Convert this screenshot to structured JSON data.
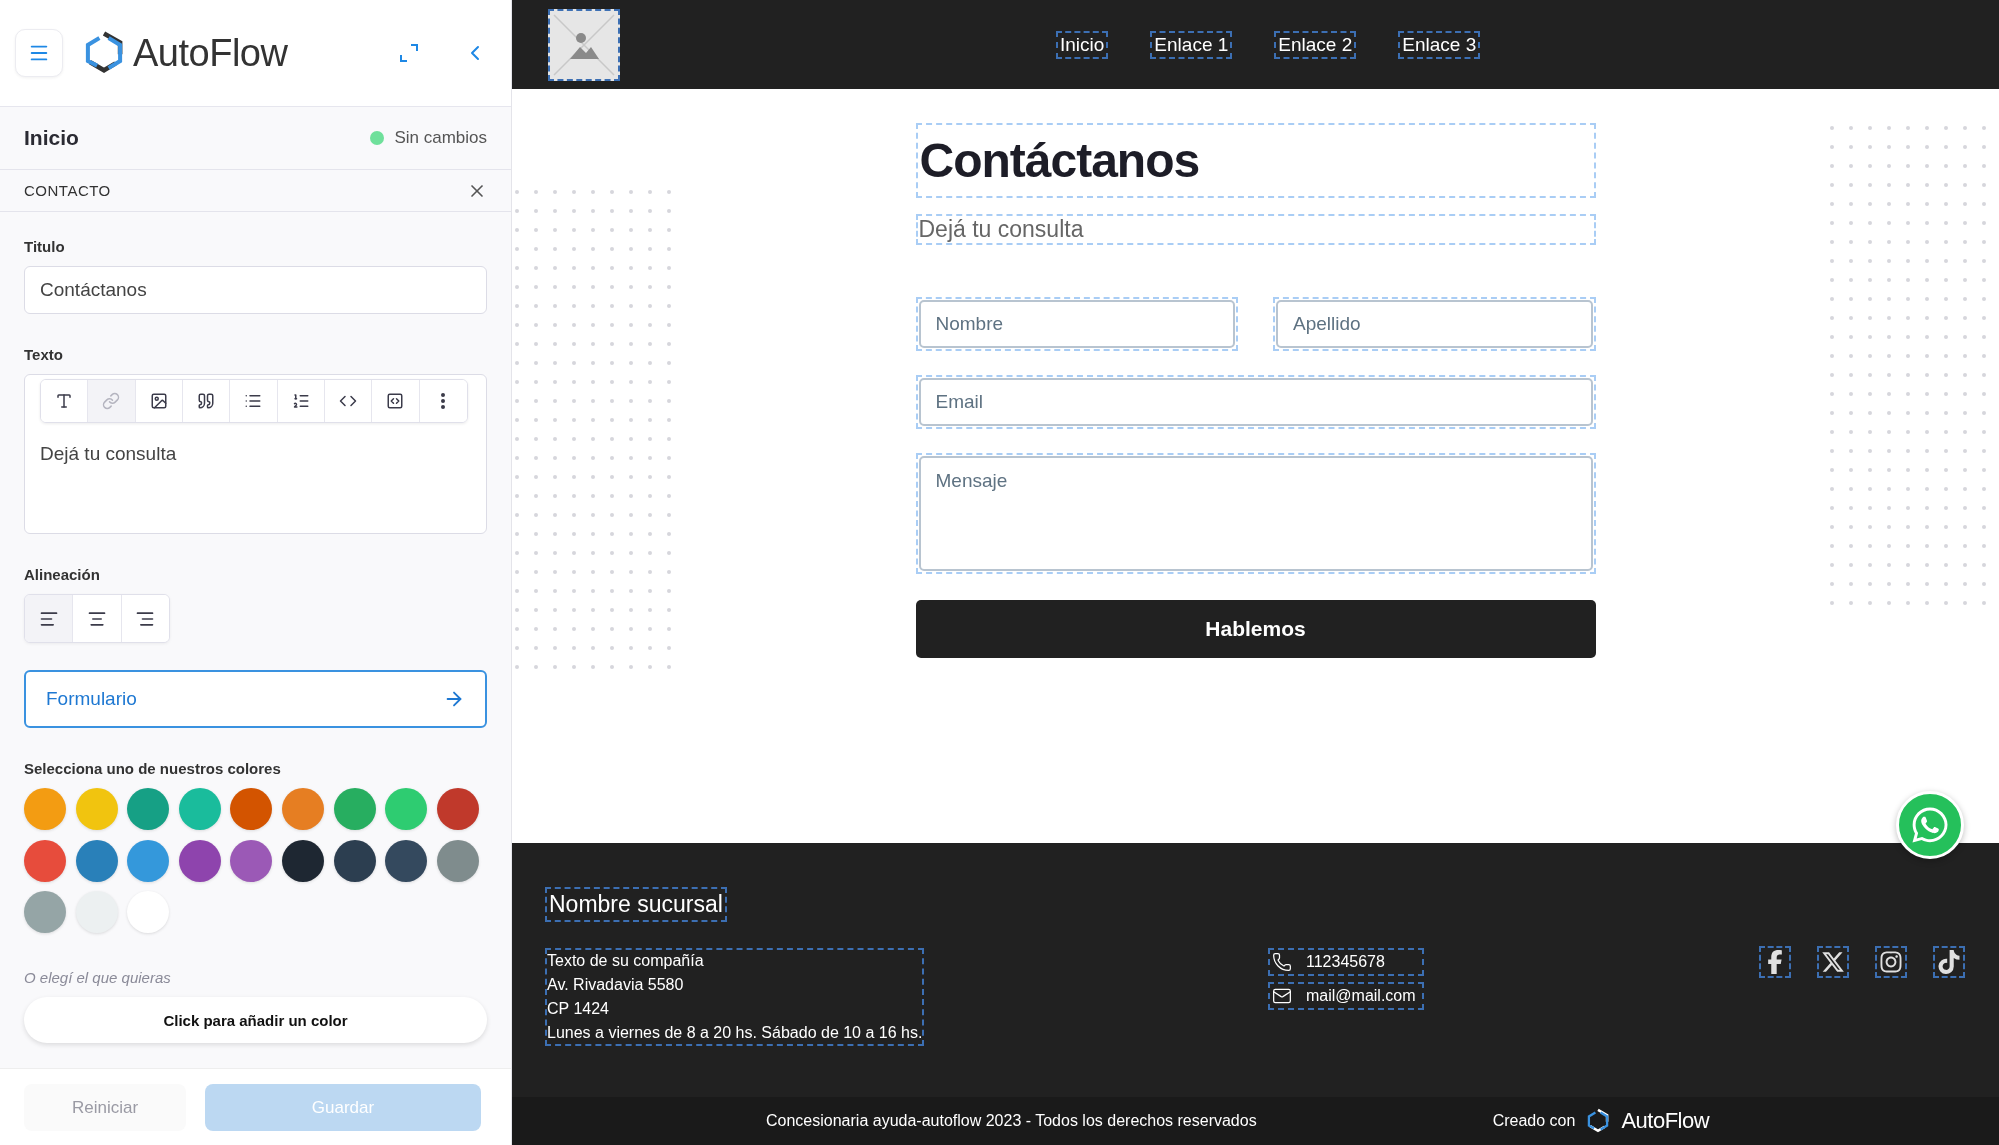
{
  "sidebar": {
    "logo": "**Auto**Flow",
    "page": {
      "title": "Inicio",
      "status": "Sin cambios"
    },
    "section": "CONTACTO",
    "fields": {
      "title_label": "Titulo",
      "title_value": "Contáctanos",
      "text_label": "Texto",
      "text_value": "Dejá tu consulta"
    },
    "toolbar": [
      {
        "kind": "text-size",
        "disabled": false
      },
      {
        "kind": "link",
        "disabled": true
      },
      {
        "kind": "image",
        "disabled": false
      },
      {
        "kind": "quote",
        "disabled": false
      },
      {
        "kind": "bullet-list",
        "disabled": false
      },
      {
        "kind": "numbered-list",
        "disabled": false
      },
      {
        "kind": "code",
        "disabled": false
      },
      {
        "kind": "code-block",
        "disabled": false
      },
      {
        "kind": "more",
        "disabled": false
      }
    ],
    "alignment_label": "Alineación",
    "alignment": [
      {
        "kind": "left",
        "selected": true
      },
      {
        "kind": "center",
        "selected": false
      },
      {
        "kind": "right",
        "selected": false
      }
    ],
    "form_link": "Formulario",
    "colors_label": "Selecciona uno de nuestros colores",
    "colors": [
      {
        "color": "#f39c12"
      },
      {
        "color": "#f1c40f"
      },
      {
        "color": "#16a085"
      },
      {
        "color": "#1abc9c"
      },
      {
        "color": "#d35400"
      },
      {
        "color": "#e67e22"
      },
      {
        "color": "#27ae60"
      },
      {
        "color": "#2ecc71"
      },
      {
        "color": "#c0392b"
      },
      {
        "color": "#e74c3c"
      },
      {
        "color": "#2980b9"
      },
      {
        "color": "#3498db"
      },
      {
        "color": "#8e44ad"
      },
      {
        "color": "#9b59b6"
      },
      {
        "color": "#1e2732"
      },
      {
        "color": "#2c3e50"
      },
      {
        "color": "#34495e"
      },
      {
        "color": "#7f8c8d"
      },
      {
        "color": "#95a5a6"
      },
      {
        "color": "#ecf0f1"
      },
      {
        "color": "#ffffff"
      }
    ],
    "custom_hint": "O elegí el que quieras",
    "add_color": "Click para añadir un color",
    "actions": [
      {
        "label": "Reiniciar",
        "kind": "secondary",
        "disabled": true
      },
      {
        "label": "Guardar",
        "kind": "primary",
        "disabled": true
      }
    ]
  },
  "preview": {
    "nav": [
      "Inicio",
      "Enlace 1",
      "Enlace 2",
      "Enlace 3"
    ],
    "heading": "Contáctanos",
    "subheading": "Dejá tu consulta",
    "fields": [
      {
        "placeholder": "Nombre",
        "kind": "half"
      },
      {
        "placeholder": "Apellido",
        "kind": "half"
      },
      {
        "placeholder": "Email",
        "kind": "full"
      },
      {
        "placeholder": "Mensaje",
        "kind": "area"
      }
    ],
    "submit": "Hablemos",
    "footer": {
      "branch": "Nombre sucursal",
      "address_lines": [
        "Texto de su compañía",
        "Av. Rivadavia 5580",
        "CP 1424",
        "Lunes a viernes de 8 a 20 hs. Sábado de 10 a 16 hs."
      ],
      "contacts": [
        {
          "kind": "phone",
          "text": "112345678"
        },
        {
          "kind": "mail",
          "text": "mail@mail.com"
        }
      ],
      "socials": [
        {
          "kind": "facebook"
        },
        {
          "kind": "x"
        },
        {
          "kind": "instagram"
        },
        {
          "kind": "tiktok"
        }
      ],
      "copyright": "Concesionaria ayuda-autoflow 2023 - Todos los derechos reservados",
      "made_with": "Creado con",
      "made_with_logo": "**Auto**Flow"
    }
  }
}
